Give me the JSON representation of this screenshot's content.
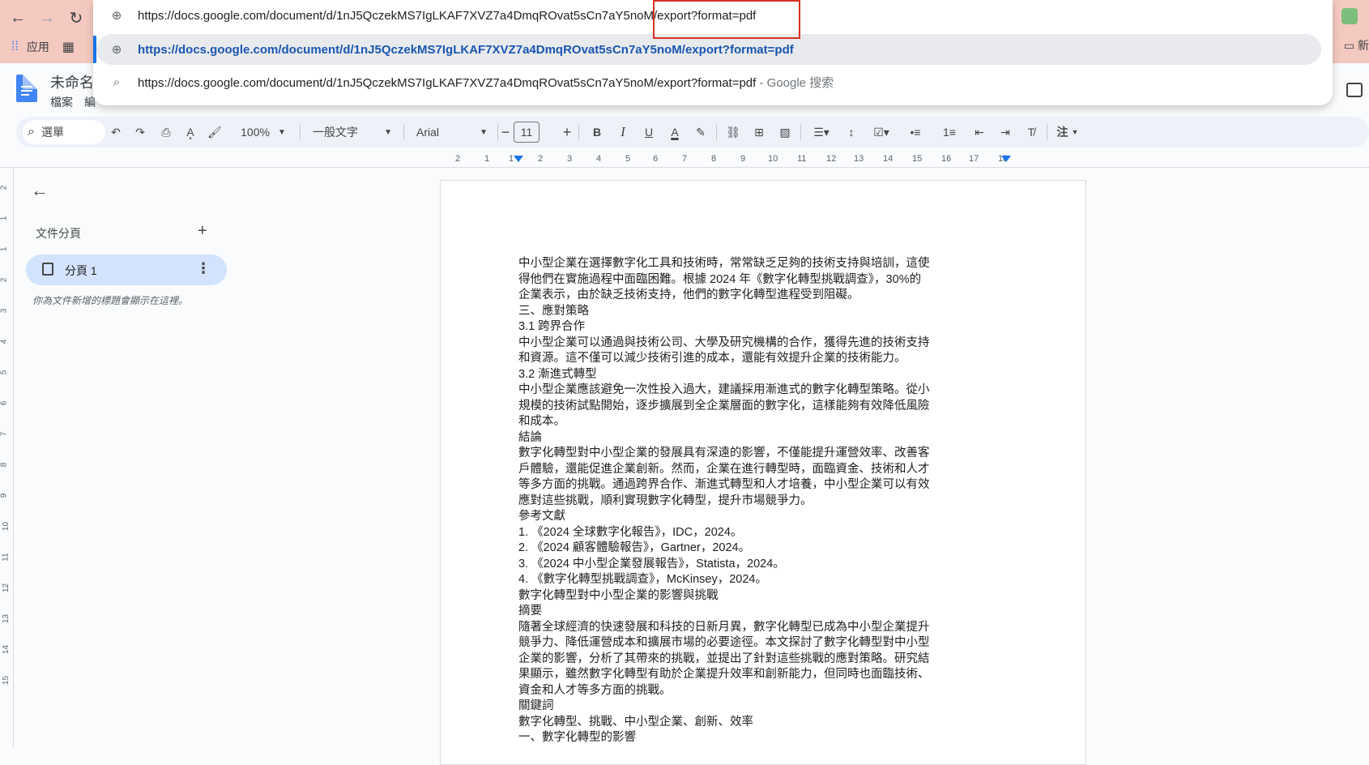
{
  "browser": {
    "bookmarks": {
      "apps_label": "应用",
      "right_label": "新"
    },
    "omnibox": {
      "input_host": "https://docs.google.com/document/d/1nJ5QczekMS7IgLKAF7XVZ7a4DmqROvat5sCn7aY5noM/",
      "input_typed": "export?format=pdf",
      "selected_suggestion": "https://docs.google.com/document/d/1nJ5QczekMS7IgLKAF7XVZ7a4DmqROvat5sCn7aY5noM/export?format=pdf",
      "search_suggestion": "https://docs.google.com/document/d/1nJ5QczekMS7IgLKAF7XVZ7a4DmqROvat5sCn7aY5noM/export?format=pdf",
      "search_hint": " - Google 搜索"
    }
  },
  "docs": {
    "title": "未命名",
    "menu": [
      "檔案",
      "編"
    ],
    "toolbar": {
      "search_label": "選單",
      "zoom": "100%",
      "style": "一般文字",
      "font": "Arial",
      "font_size": "11",
      "more_label": "注"
    },
    "ruler": [
      "2",
      "1",
      "1",
      "2",
      "3",
      "4",
      "5",
      "6",
      "7",
      "8",
      "9",
      "10",
      "11",
      "12",
      "13",
      "14",
      "15",
      "16",
      "17",
      "18"
    ],
    "vruler": [
      "2",
      "1",
      "1",
      "2",
      "3",
      "4",
      "5",
      "6",
      "7",
      "8",
      "9",
      "10",
      "11",
      "12",
      "13",
      "14",
      "15"
    ],
    "sidebar": {
      "outline_title": "文件分頁",
      "tab_label": "分頁 1",
      "hint": "你為文件新增的標題會顯示在這裡。"
    },
    "body": [
      "中小型企業在選擇數字化工具和技術時，常常缺乏足夠的技術支持與培訓，這使",
      "得他們在實施過程中面臨困難。根據 2024 年《數字化轉型挑戰調查》，30%的",
      "企業表示，由於缺乏技術支持，他們的數字化轉型進程受到阻礙。",
      "三、應對策略",
      "3.1 跨界合作",
      "中小型企業可以通過與技術公司、大學及研究機構的合作，獲得先進的技術支持",
      "和資源。這不僅可以減少技術引進的成本，還能有效提升企業的技術能力。",
      "3.2 漸進式轉型",
      "中小型企業應該避免一次性投入過大，建議採用漸進式的數字化轉型策略。從小",
      "規模的技術試點開始，逐步擴展到全企業層面的數字化，這樣能夠有效降低風險",
      "和成本。",
      "結論",
      "數字化轉型對中小型企業的發展具有深遠的影響，不僅能提升運營效率、改善客",
      "戶體驗，還能促進企業創新。然而，企業在進行轉型時，面臨資金、技術和人才",
      "等多方面的挑戰。通過跨界合作、漸進式轉型和人才培養，中小型企業可以有效",
      "應對這些挑戰，順利實現數字化轉型，提升市場競爭力。",
      "參考文獻",
      "1. 《2024 全球數字化報告》，IDC，2024。",
      "2. 《2024 顧客體驗報告》，Gartner，2024。",
      "3. 《2024 中小型企業發展報告》，Statista，2024。",
      "4. 《數字化轉型挑戰調查》，McKinsey，2024。",
      "數字化轉型對中小型企業的影響與挑戰",
      "摘要",
      "隨著全球經濟的快速發展和科技的日新月異，數字化轉型已成為中小型企業提升",
      "競爭力、降低運營成本和擴展市場的必要途徑。本文探討了數字化轉型對中小型",
      "企業的影響，分析了其帶來的挑戰，並提出了針對這些挑戰的應對策略。研究結",
      "果顯示，雖然數字化轉型有助於企業提升效率和創新能力，但同時也面臨技術、",
      "資金和人才等多方面的挑戰。",
      "關鍵詞",
      "數字化轉型、挑戰、中小型企業、創新、效率",
      "一、數字化轉型的影響"
    ]
  }
}
